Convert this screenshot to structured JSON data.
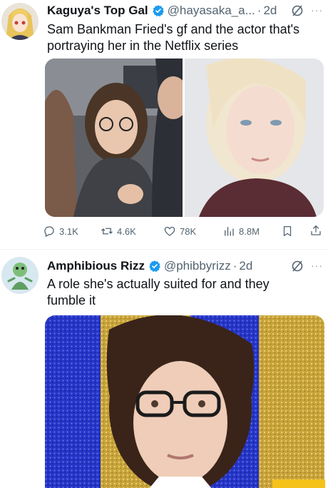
{
  "tweet1": {
    "name": "Kaguya's Top Gal",
    "handle": "@hayasaka_a...",
    "dot": "·",
    "time": "2d",
    "more": "···",
    "text": "Sam Bankman Fried's gf and the actor that's portraying her in the Netflix series",
    "stats": {
      "replies": "3.1K",
      "retweets": "4.6K",
      "likes": "78K",
      "views": "8.8M"
    }
  },
  "tweet2": {
    "name": "Amphibious Rizz",
    "handle": "@phibbyrizz",
    "dot": "·",
    "time": "2d",
    "more": "···",
    "text": "A role she's actually suited for and they fumble it"
  },
  "colors": {
    "verified": "#1d9bf0",
    "secondary_text": "#536471",
    "glitter_blue": "#2636c8",
    "glitter_gold": "#c9a43a"
  },
  "icons": {
    "reply": "reply-icon",
    "retweet": "retweet-icon",
    "like": "heart-icon",
    "views": "views-icon",
    "bookmark": "bookmark-icon",
    "share": "share-icon",
    "grok": "grok-icon"
  }
}
